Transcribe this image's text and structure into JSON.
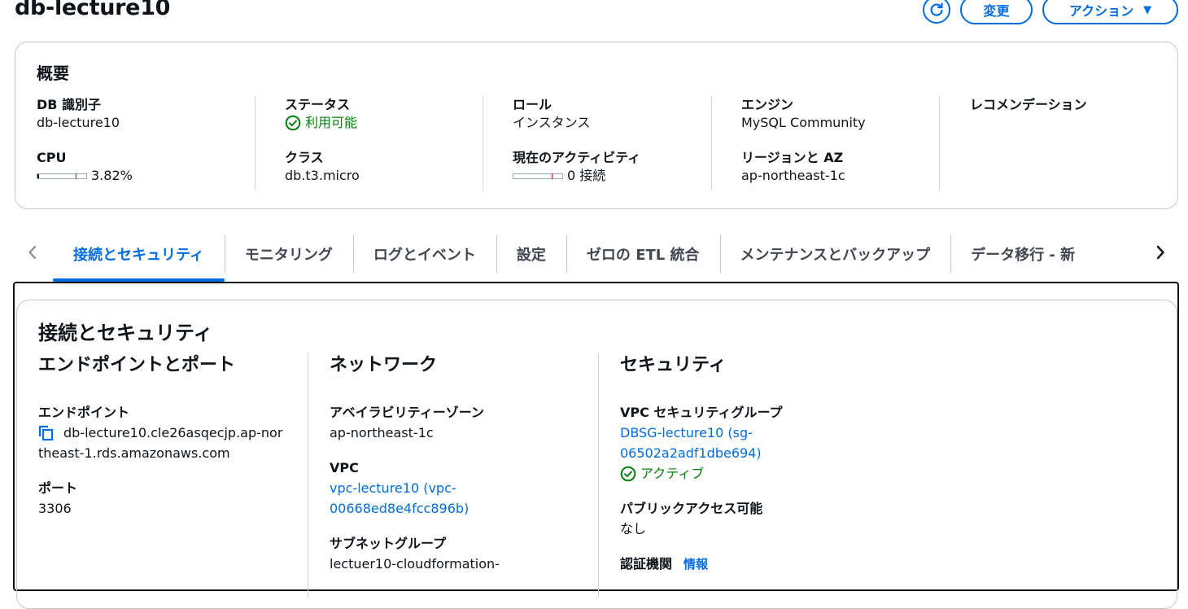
{
  "page": {
    "title": "db-lecture10"
  },
  "header_actions": {
    "refresh_icon": "refresh-icon",
    "modify_label": "変更",
    "actions_label": "アクション",
    "actions_caret": "▼"
  },
  "summary": {
    "title": "概要",
    "db_identifier": {
      "label": "DB 識別子",
      "value": "db-lecture10"
    },
    "cpu": {
      "label": "CPU",
      "value": "3.82%",
      "percent": 3.82
    },
    "status": {
      "label": "ステータス",
      "value": "利用可能"
    },
    "class": {
      "label": "クラス",
      "value": "db.t3.micro"
    },
    "role": {
      "label": "ロール",
      "value": "インスタンス"
    },
    "activity": {
      "label": "現在のアクティビティ",
      "value": "0 接続",
      "connections": 0
    },
    "engine": {
      "label": "エンジン",
      "value": "MySQL Community"
    },
    "region_az": {
      "label": "リージョンと AZ",
      "value": "ap-northeast-1c"
    },
    "recommendations": {
      "label": "レコメンデーション"
    }
  },
  "tabs": [
    {
      "label": "接続とセキュリティ"
    },
    {
      "label": "モニタリング"
    },
    {
      "label": "ログとイベント"
    },
    {
      "label": "設定"
    },
    {
      "label": "ゼロの ETL 統合"
    },
    {
      "label": "メンテナンスとバックアップ"
    },
    {
      "label": "データ移行 - 新"
    }
  ],
  "connectivity": {
    "title": "接続とセキュリティ",
    "endpoint_port": {
      "title": "エンドポイントとポート",
      "endpoint_label": "エンドポイント",
      "endpoint_value_line1": "db-lecture10.cle26asqecjp.ap-nor",
      "endpoint_value_line2": "theast-1.rds.amazonaws.com",
      "port_label": "ポート",
      "port_value": "3306"
    },
    "network": {
      "title": "ネットワーク",
      "az_label": "アベイラビリティーゾーン",
      "az_value": "ap-northeast-1c",
      "vpc_label": "VPC",
      "vpc_value_line1": "vpc-lecture10 (vpc-",
      "vpc_value_line2": "00668ed8e4fcc896b)",
      "subnet_label": "サブネットグループ",
      "subnet_value": "lectuer10-cloudformation-"
    },
    "security": {
      "title": "セキュリティ",
      "sg_label": "VPC セキュリティグループ",
      "sg_value_line1": "DBSG-lecture10 (sg-",
      "sg_value_line2": "06502a2adf1dbe694)",
      "sg_status": "アクティブ",
      "public_label": "パブリックアクセス可能",
      "public_value": "なし",
      "ca_label": "認証機関",
      "ca_info": "情報"
    }
  },
  "colors": {
    "accent": "#006ce0",
    "success": "#037f0c",
    "text": "#0f141a",
    "border": "#c6c6cd"
  }
}
